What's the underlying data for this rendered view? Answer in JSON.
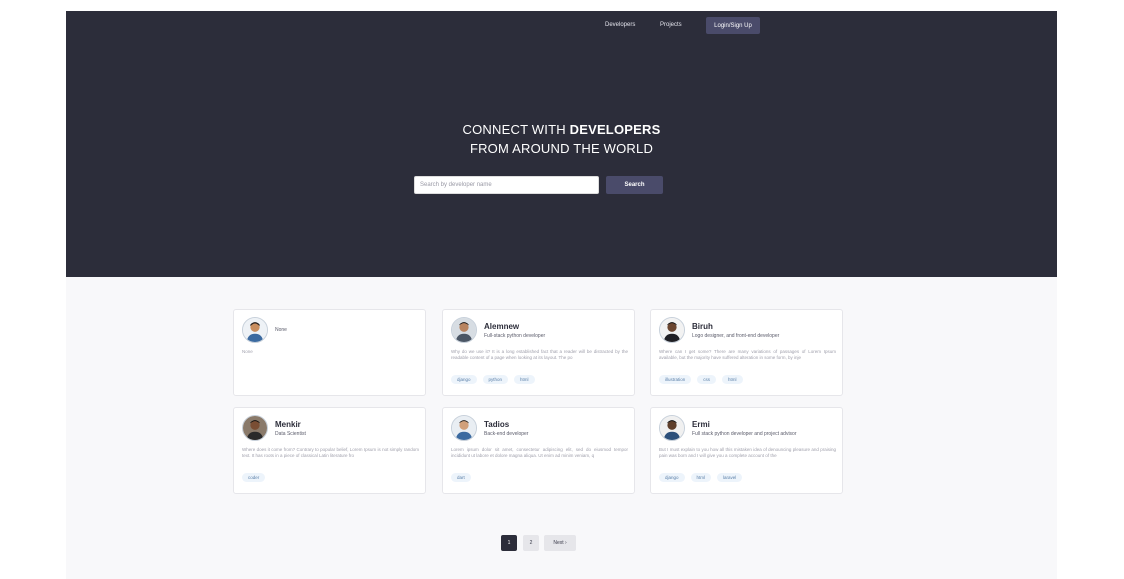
{
  "nav": {
    "developers": "Developers",
    "projects": "Projects",
    "login": "Login/Sign Up"
  },
  "hero": {
    "line1_prefix": "CONNECT WITH ",
    "line1_bold": "DEVELOPERS",
    "line2": "FROM AROUND THE WORLD"
  },
  "search": {
    "placeholder": "Search by developer name",
    "button": "Search"
  },
  "cards": [
    {
      "name": "None",
      "title": "",
      "bio": "None",
      "tags": []
    },
    {
      "name": "Alemnew",
      "title": "Full-stack python developer",
      "bio": "Why do we use it? It is a long established fact that a reader will be distracted by the readable content of a page when looking at its layout. The po",
      "tags": [
        "django",
        "python",
        "html"
      ]
    },
    {
      "name": "Biruh",
      "title": "Logo designer, and front-end developer",
      "bio": "Where can I get some? There are many variations of passages of Lorem Ipsum available, but the majority have suffered alteration in some form, by inje",
      "tags": [
        "illustration",
        "css",
        "html"
      ]
    },
    {
      "name": "Menkir",
      "title": "Data Scientist",
      "bio": "Where does it come from? Contrary to popular belief, Lorem Ipsum is not simply random text. It has roots in a piece of classical Latin literature fro",
      "tags": [
        "coder"
      ]
    },
    {
      "name": "Tadios",
      "title": "Back-end developer",
      "bio": "Lorem ipsum dolor sit amet, consectetur adipiscing elit, sed do eiusmod tempor incididunt ut labore et dolore magna aliqua. Ut enim ad minim veniam, q",
      "tags": [
        "dart"
      ]
    },
    {
      "name": "Ermi",
      "title": "Full stack python developer and project advisor",
      "bio": "But I must explain to you how all this mistaken idea of denouncing pleasure and praising pain was born and I will give you a complete account of the",
      "tags": [
        "django",
        "html",
        "laravel"
      ]
    }
  ],
  "pagination": {
    "page1": "1",
    "page2": "2",
    "next": "Next ›"
  },
  "colors": {
    "hero_bg": "#2c2d3a",
    "accent": "#4a4b6a",
    "page_bg": "#f8f8fa",
    "tag_bg": "#edf4fb"
  }
}
